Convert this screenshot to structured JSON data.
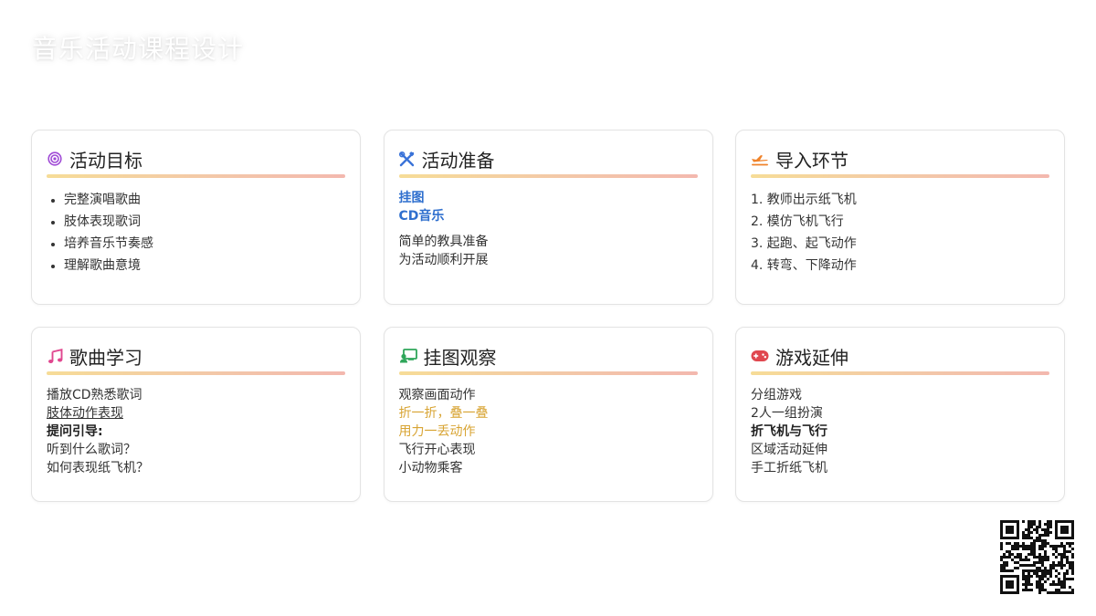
{
  "page": {
    "title": "音乐活动课程设计"
  },
  "colors": {
    "target_icon": "#a04ad6",
    "tools_icon": "#3a73d8",
    "plane_icon": "#f0832a",
    "music_icon": "#e0478f",
    "board_icon": "#2fa65a",
    "game_icon": "#e0474f",
    "rule_start": "#f6dc97",
    "rule_end": "#f3b8ae",
    "highlight_blue": "#2f6fce",
    "highlight_gold": "#d8a433"
  },
  "cards": {
    "goals": {
      "icon": "target-icon",
      "title": "活动目标",
      "items": [
        "完整演唱歌曲",
        "肢体表现歌词",
        "培养音乐节奏感",
        "理解歌曲意境"
      ]
    },
    "prep": {
      "icon": "tools-icon",
      "title": "活动准备",
      "highlights": [
        "挂图",
        "CD音乐"
      ],
      "lines": [
        "简单的教具准备",
        "为活动顺利开展"
      ]
    },
    "intro": {
      "icon": "plane-icon",
      "title": "导入环节",
      "steps": [
        "1. 教师出示纸飞机",
        "2. 模仿飞机飞行",
        "3. 起跑、起飞动作",
        "4. 转弯、下降动作"
      ]
    },
    "song": {
      "icon": "music-note-icon",
      "title": "歌曲学习",
      "line1": "播放CD熟悉歌词",
      "line2": "肢体动作表现",
      "line3": "提问引导:",
      "line4": "听到什么歌词？",
      "line5": "如何表现纸飞机？"
    },
    "observe": {
      "icon": "board-icon",
      "title": "挂图观察",
      "line1": "观察画面动作",
      "line2": "折一折，叠一叠",
      "line3": "用力一丢动作",
      "line4": "飞行开心表现",
      "line5": "小动物乘客"
    },
    "game": {
      "icon": "gamepad-icon",
      "title": "游戏延伸",
      "line1": "分组游戏",
      "line2": "2人一组扮演",
      "line3": "折飞机与飞行",
      "line4": "区域活动延伸",
      "line5": "手工折纸飞机"
    }
  },
  "qr": {
    "icon": "qr-code-icon"
  }
}
